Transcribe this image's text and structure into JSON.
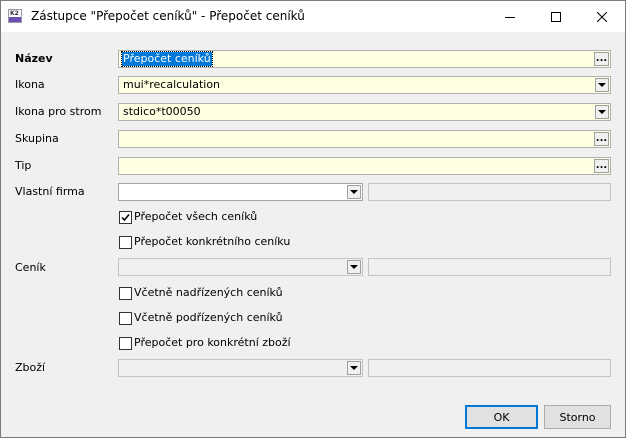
{
  "window": {
    "title": "Zástupce \"Přepočet ceníků\" - Přepočet ceníků",
    "app_icon_text": "K2"
  },
  "form": {
    "nazev": {
      "label": "Název",
      "value": "Přepočet ceníků"
    },
    "ikona": {
      "label": "Ikona",
      "value": "mui*recalculation"
    },
    "ikona_strom": {
      "label": "Ikona pro strom",
      "value": "stdico*t00050"
    },
    "skupina": {
      "label": "Skupina",
      "value": ""
    },
    "tip": {
      "label": "Tip",
      "value": ""
    },
    "vlastni_firma": {
      "label": "Vlastní firma",
      "value": ""
    },
    "prepocet_vsech": {
      "label": "Přepočet všech ceníků",
      "checked": true
    },
    "prepocet_konkretniho": {
      "label": "Přepočet konkrétního ceníku",
      "checked": false
    },
    "cenik": {
      "label": "Ceník",
      "value": ""
    },
    "vcetne_nadrizenych": {
      "label": "Včetně nadřízených ceníků",
      "checked": false
    },
    "vcetne_podrizenych": {
      "label": "Včetně podřízených ceníků",
      "checked": false
    },
    "prepocet_zbozi": {
      "label": "Přepočet pro konkrétní zboží",
      "checked": false
    },
    "zbozi": {
      "label": "Zboží",
      "value": ""
    }
  },
  "buttons": {
    "ok": "OK",
    "cancel": "Storno"
  },
  "ellipsis_text": "..."
}
